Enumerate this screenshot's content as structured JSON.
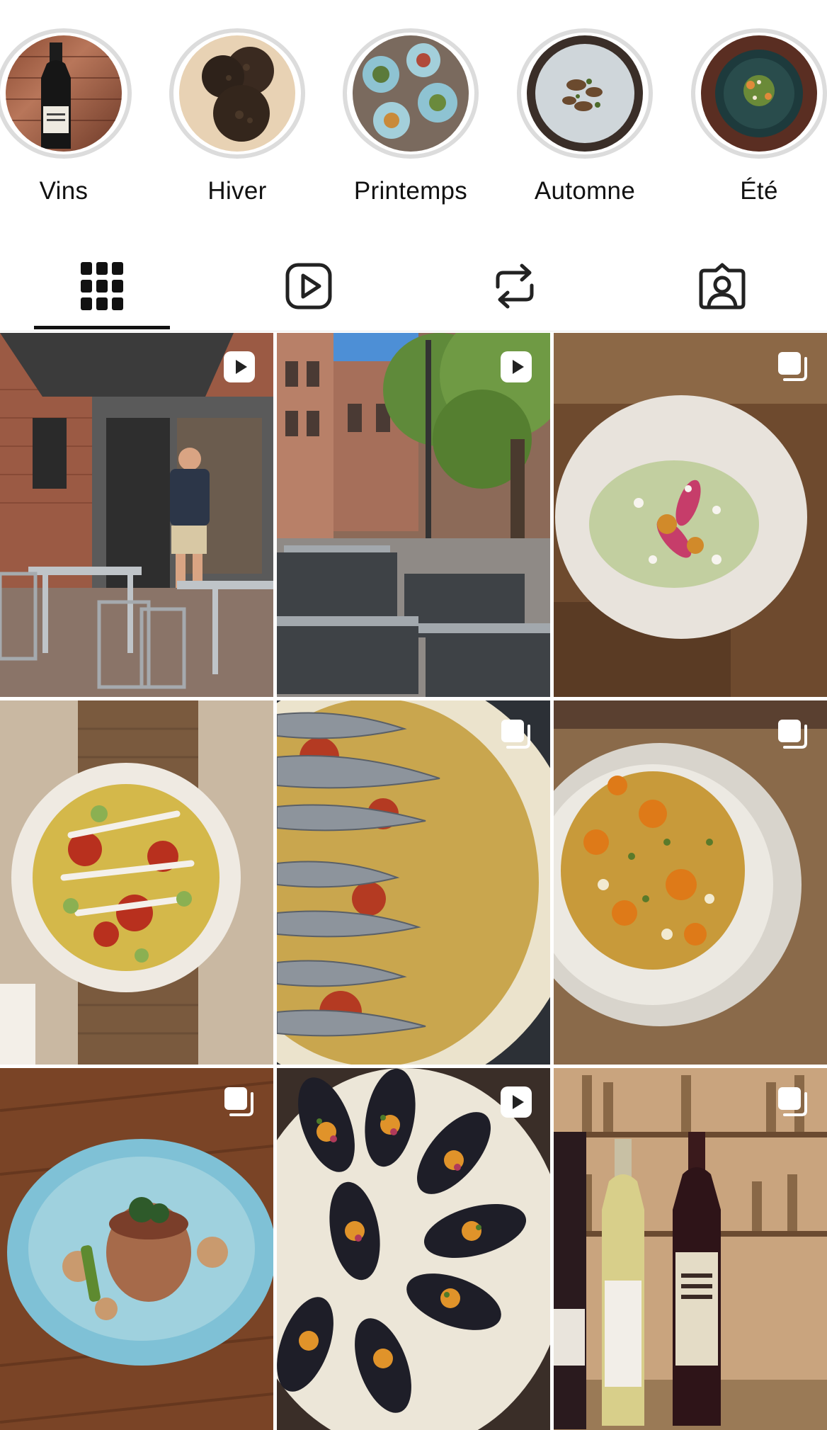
{
  "highlights": [
    {
      "label": "Vins",
      "thumb": "wine-bottle-highlight"
    },
    {
      "label": "Hiver",
      "thumb": "truffle-highlight"
    },
    {
      "label": "Printemps",
      "thumb": "dishes-highlight"
    },
    {
      "label": "Automne",
      "thumb": "mushroom-plate-highlight"
    },
    {
      "label": "Été",
      "thumb": "green-bowl-highlight"
    }
  ],
  "tabs": [
    {
      "name": "tab-posts-grid",
      "icon": "grid-icon",
      "active": true
    },
    {
      "name": "tab-reels",
      "icon": "reels-icon",
      "active": false
    },
    {
      "name": "tab-reposts",
      "icon": "repost-icon",
      "active": false
    },
    {
      "name": "tab-tagged",
      "icon": "tagged-person-icon",
      "active": false
    }
  ],
  "posts": [
    {
      "subject": "restaurant-terrace-with-man",
      "badge": "reel-play-icon"
    },
    {
      "subject": "street-terrace-tables",
      "badge": "reel-play-icon"
    },
    {
      "subject": "plate-with-pink-onions",
      "badge": "carousel-icon"
    },
    {
      "subject": "tuna-salad-bowl",
      "badge": "none"
    },
    {
      "subject": "anchovies-plate",
      "badge": "carousel-icon"
    },
    {
      "subject": "corn-salad-plate",
      "badge": "carousel-icon"
    },
    {
      "subject": "tournedos-blue-plate",
      "badge": "carousel-icon"
    },
    {
      "subject": "mussels-platter",
      "badge": "reel-play-icon"
    },
    {
      "subject": "wine-bottles",
      "badge": "carousel-icon"
    }
  ],
  "colors": {
    "ring": "#dcdcdc",
    "active_tab": "#111111",
    "icon": "#222222"
  }
}
